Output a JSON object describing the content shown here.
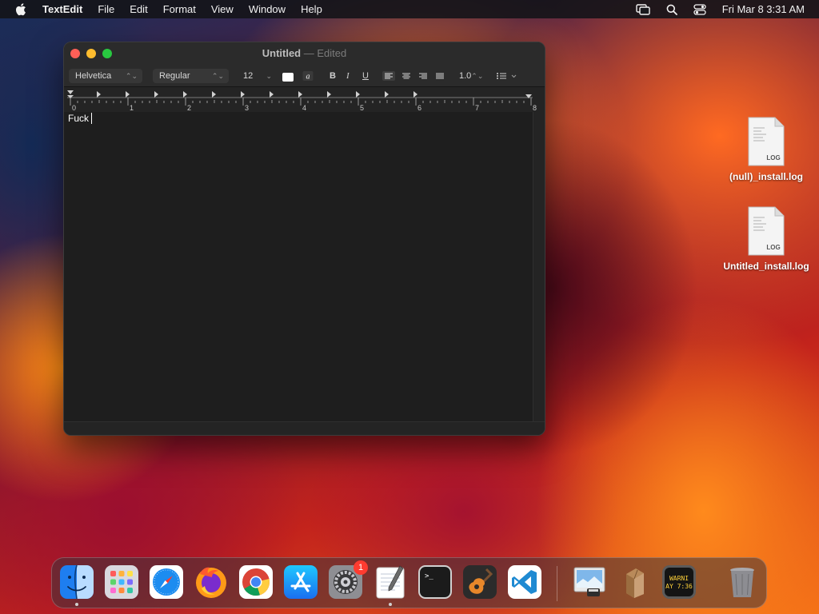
{
  "menubar": {
    "app_name": "TextEdit",
    "menus": [
      "File",
      "Edit",
      "Format",
      "View",
      "Window",
      "Help"
    ],
    "clock": "Fri Mar 8  3:31 AM"
  },
  "window": {
    "title": "Untitled",
    "separator": "—",
    "status": "Edited",
    "toolbar": {
      "font_family": "Helvetica",
      "font_style": "Regular",
      "font_size": "12",
      "bold": "B",
      "italic": "I",
      "underline": "U",
      "line_spacing": "1.0"
    },
    "ruler_labels": [
      "0",
      "1",
      "2",
      "3",
      "4",
      "5",
      "6",
      "7",
      "8"
    ],
    "document_text": "Fuck"
  },
  "desktop": {
    "icons": [
      {
        "label": "(null)_install.log",
        "badge": "LOG"
      },
      {
        "label": "Untitled_install.log",
        "badge": "LOG"
      }
    ]
  },
  "dock": {
    "items": [
      {
        "name": "Finder"
      },
      {
        "name": "Launchpad"
      },
      {
        "name": "Safari"
      },
      {
        "name": "Firefox"
      },
      {
        "name": "Chrome"
      },
      {
        "name": "App Store"
      },
      {
        "name": "System Settings",
        "badge": "1"
      },
      {
        "name": "TextEdit"
      },
      {
        "name": "Terminal",
        "glyph": ">_"
      },
      {
        "name": "GarageBand"
      },
      {
        "name": "Visual Studio Code"
      },
      {
        "name": "Preview"
      },
      {
        "name": "Archive"
      },
      {
        "name": "Console",
        "glyph_top": "WARNI",
        "glyph_bottom": "AY 7:36"
      },
      {
        "name": "Trash"
      }
    ]
  }
}
